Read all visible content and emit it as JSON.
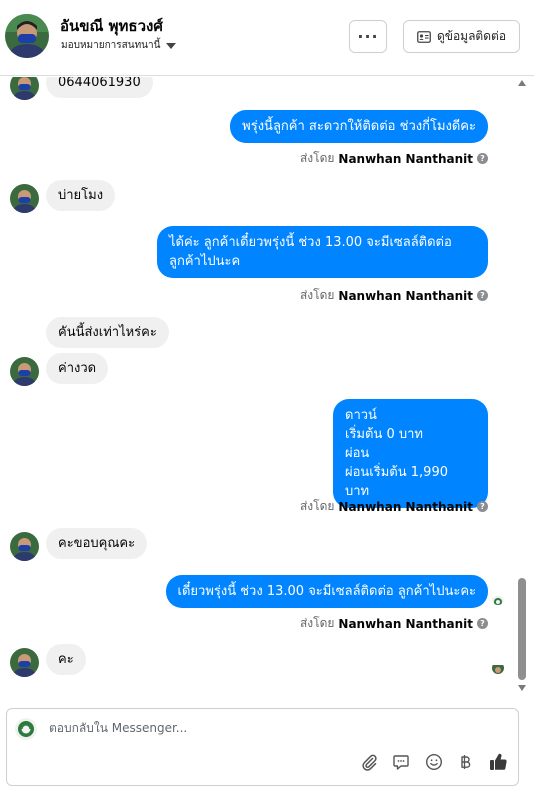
{
  "header": {
    "name": "อันขณี พุทธวงศ์",
    "assign_label": "มอบหมายการสนทนานี้",
    "more_label": "···",
    "info_button_label": "ดูข้อมูลติดต่อ"
  },
  "messages": [
    {
      "dir": "in",
      "text": "0644061930"
    },
    {
      "dir": "out",
      "text": "พรุ่งนี้ลูกค้า สะดวกให้ติดต่อ ช่วงกี่โมงดีคะ",
      "sent_by_prefix": "ส่งโดย",
      "sent_by_name": "Nanwhan Nanthanit"
    },
    {
      "dir": "in",
      "text": "บ่ายโมง"
    },
    {
      "dir": "out",
      "lines": [
        "ได้ค่ะ ลูกค้าเดี๋ยวพรุ่งนี้ ช่วง 13.00 จะมีเซลล์ติดต่อ",
        "ลูกค้าไปนะค"
      ],
      "sent_by_prefix": "ส่งโดย",
      "sent_by_name": "Nanwhan Nanthanit"
    },
    {
      "dir": "in",
      "text": "คันนี้ส่งเท่าไหร่คะ"
    },
    {
      "dir": "in",
      "text": "ค่างวด"
    },
    {
      "dir": "out",
      "lines": [
        "ดาวน์",
        "เริ่มต้น 0 บาท",
        "ผ่อน",
        "ผ่อนเริ่มต้น 1,990 บาท"
      ],
      "sent_by_prefix": "ส่งโดย",
      "sent_by_name": "Nanwhan Nanthanit"
    },
    {
      "dir": "in",
      "text": "คะขอบคุณคะ"
    },
    {
      "dir": "out",
      "text": "เดี๋ยวพรุ่งนี้ ช่วง 13.00 จะมีเซลล์ติดต่อ ลูกค้าไปนะคะ",
      "sent_by_prefix": "ส่งโดย",
      "sent_by_name": "Nanwhan Nanthanit"
    },
    {
      "dir": "in",
      "text": "คะ"
    }
  ],
  "composer": {
    "placeholder": "ตอบกลับใน Messenger..."
  },
  "tools": [
    "attach-icon",
    "saved-reply-icon",
    "emoji-icon",
    "payment-icon",
    "thumbs-up-icon"
  ],
  "colors": {
    "accent": "#0084ff",
    "incoming_bubble": "#f0f0f0",
    "muted_text": "#65676b"
  }
}
